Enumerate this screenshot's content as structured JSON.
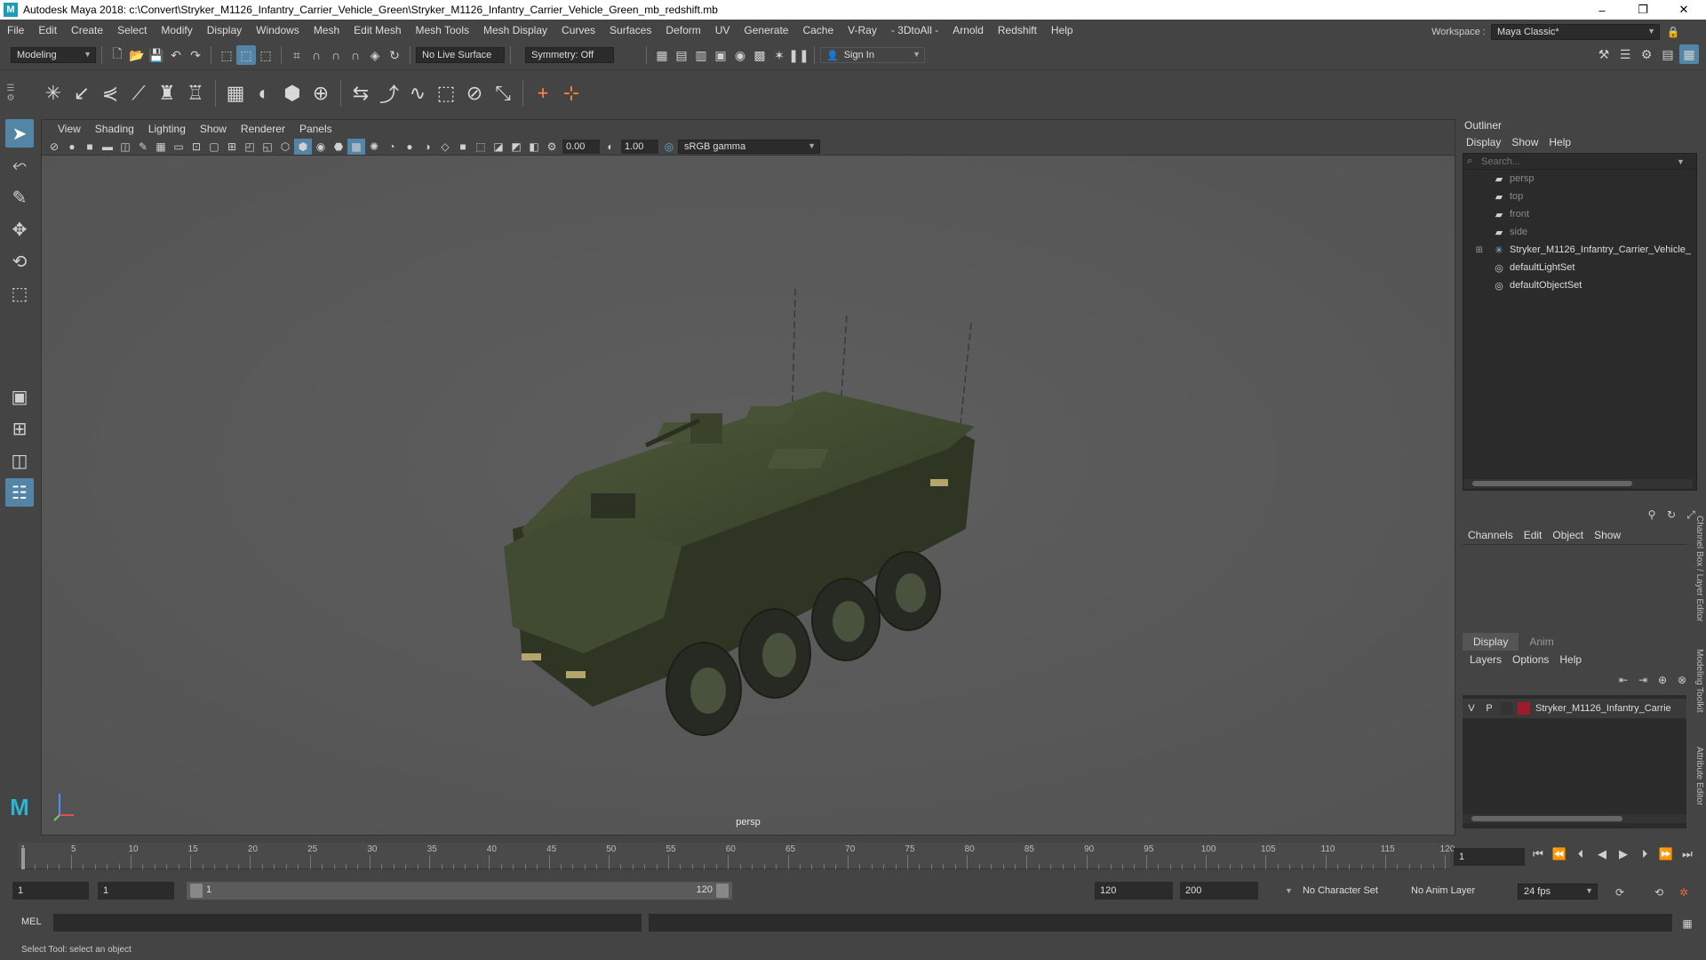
{
  "window": {
    "title": "Autodesk Maya 2018: c:\\Convert\\Stryker_M1126_Infantry_Carrier_Vehicle_Green\\Stryker_M1126_Infantry_Carrier_Vehicle_Green_mb_redshift.mb",
    "logo": "M",
    "controls": {
      "minimize": "–",
      "restore": "❐",
      "close": "✕"
    }
  },
  "menubar": {
    "items": [
      "File",
      "Edit",
      "Create",
      "Select",
      "Modify",
      "Display",
      "Windows",
      "Mesh",
      "Edit Mesh",
      "Mesh Tools",
      "Mesh Display",
      "Curves",
      "Surfaces",
      "Deform",
      "UV",
      "Generate",
      "Cache",
      "V-Ray",
      "- 3DtoAll -",
      "Arnold",
      "Redshift",
      "Help"
    ],
    "workspace_label": "Workspace :",
    "workspace_value": "Maya Classic*"
  },
  "statusline": {
    "mode": "Modeling",
    "live_surface": "No Live Surface",
    "symmetry": "Symmetry: Off",
    "sign_in": "Sign In"
  },
  "viewport": {
    "menu": [
      "View",
      "Shading",
      "Lighting",
      "Show",
      "Renderer",
      "Panels"
    ],
    "exposure": "0.00",
    "gamma": "1.00",
    "color_space": "sRGB gamma",
    "camera_label": "persp"
  },
  "outliner": {
    "title": "Outliner",
    "menu": [
      "Display",
      "Show",
      "Help"
    ],
    "search_placeholder": "Search...",
    "items": [
      {
        "label": "persp",
        "icon": "camera-icon",
        "dim": true
      },
      {
        "label": "top",
        "icon": "camera-icon",
        "dim": true
      },
      {
        "label": "front",
        "icon": "camera-icon",
        "dim": true
      },
      {
        "label": "side",
        "icon": "camera-icon",
        "dim": true
      },
      {
        "label": "Stryker_M1126_Infantry_Carrier_Vehicle_",
        "icon": "group-icon",
        "dim": false
      },
      {
        "label": "defaultLightSet",
        "icon": "set-icon",
        "dim": false
      },
      {
        "label": "defaultObjectSet",
        "icon": "set-icon",
        "dim": false
      }
    ]
  },
  "channelbox": {
    "menu": [
      "Channels",
      "Edit",
      "Object",
      "Show"
    ]
  },
  "layers": {
    "tabs": [
      "Display",
      "Anim"
    ],
    "menu": [
      "Layers",
      "Options",
      "Help"
    ],
    "row": {
      "v": "V",
      "p": "P",
      "name": "Stryker_M1126_Infantry_Carrie",
      "color": "#a01a2e"
    }
  },
  "side_tabs": [
    "Channel Box / Layer Editor",
    "Modeling Toolkit",
    "Attribute Editor"
  ],
  "timeslider": {
    "ticks": [
      1,
      5,
      10,
      15,
      20,
      25,
      30,
      35,
      40,
      45,
      50,
      55,
      60,
      65,
      70,
      75,
      80,
      85,
      90,
      95,
      100,
      105,
      110,
      115,
      120
    ],
    "current_frame": "1"
  },
  "range": {
    "start": "1",
    "playback_start": "1",
    "range_start_label": "1",
    "range_end_label": "120",
    "playback_end": "120",
    "end": "200",
    "character_set": "No Character Set",
    "anim_layer": "No Anim Layer",
    "fps": "24 fps"
  },
  "command": {
    "language": "MEL"
  },
  "help": {
    "text": "Select Tool: select an object"
  }
}
